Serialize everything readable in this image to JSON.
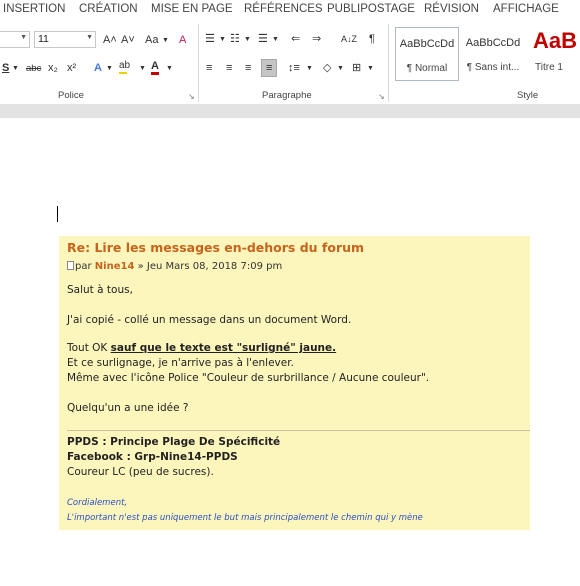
{
  "tabs": [
    "INSERTION",
    "CRÉATION",
    "MISE EN PAGE",
    "RÉFÉRENCES",
    "PUBLIPOSTAGE",
    "RÉVISION",
    "AFFICHAGE"
  ],
  "font": {
    "size_value": "11",
    "group_label": "Police",
    "buttons": {
      "grow": "A˄",
      "shrink": "A˅",
      "case": "Aa",
      "clear": "A",
      "underline": "S",
      "strike": "abc",
      "subscript": "x₂",
      "superscript": "x²",
      "effects": "A",
      "highlight": "ab",
      "color": "A"
    }
  },
  "paragraph": {
    "group_label": "Paragraphe",
    "buttons": {
      "bullets": "☰",
      "numbering": "☷",
      "multilevel": "☰",
      "outdent": "⇐",
      "indent": "⇒",
      "sort": "A↓Z",
      "show_marks": "¶",
      "align_left": "≡",
      "align_center": "≡",
      "align_right": "≡",
      "justify": "≡",
      "line_spacing": "↕≡",
      "shading": "◇",
      "borders": "⊞"
    }
  },
  "styles": {
    "group_label": "Style",
    "items": [
      {
        "sample": "AaBbCcDd",
        "name": "¶ Normal"
      },
      {
        "sample": "AaBbCcDd",
        "name": "¶ Sans int..."
      },
      {
        "sample": "AaB",
        "name": "Titre 1"
      }
    ]
  },
  "post": {
    "title": "Re: Lire les messages en-dehors du forum",
    "meta_by": "par",
    "author": "Nine14",
    "date": "» Jeu Mars 08, 2018 7:09 pm",
    "greeting": "Salut à tous,",
    "line1": "J'ai copié - collé un message dans un document Word.",
    "line2_start": "Tout OK ",
    "line2_emph": "sauf que le texte est \"surligné\" jaune.",
    "line3": "Et ce surlignage, je n'arrive pas à l'enlever.",
    "line4": "Même avec l'icône Police \"Couleur de surbrillance / Aucune couleur\".",
    "question": "Quelqu'un a une idée ?",
    "sig1": "PPDS : Principe Plage De Spécificité",
    "sig2": "Facebook : Grp-Nine14-PPDS",
    "sig3": "Coureur LC (peu de sucres).",
    "sig4": "Cordialement,",
    "sig5": "L'important n'est pas uniquement le but mais principalement le chemin qui y mène"
  },
  "colors": {
    "title_accent": "#c7631b",
    "highlight_bg": "#fcf6bd",
    "signature_blue": "#2a4fc4",
    "heading_red": "#c00000"
  }
}
